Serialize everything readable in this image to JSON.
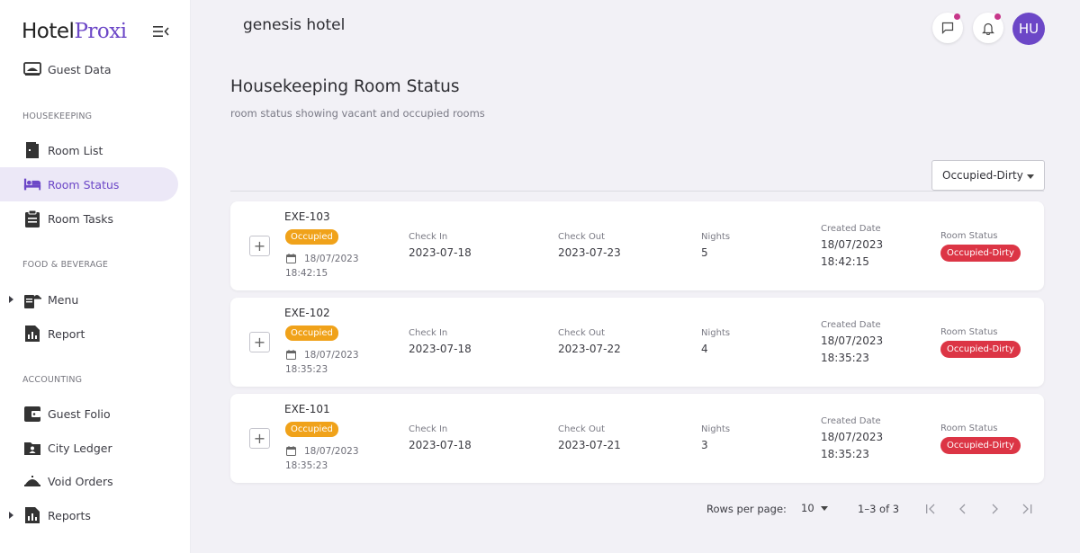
{
  "app": {
    "logo_main": "Hotel",
    "logo_brand": "Proxi",
    "brand_color": "#6c47c7"
  },
  "sidebar": {
    "partial_item": "Guest Data",
    "sections": {
      "housekeeping": "HOUSEKEEPING",
      "food_beverage": "FOOD & BEVERAGE",
      "accounting": "ACCOUNTING"
    },
    "items": {
      "room_list": "Room List",
      "room_status": "Room Status",
      "room_tasks": "Room Tasks",
      "menu": "Menu",
      "report": "Report",
      "guest_folio": "Guest Folio",
      "city_ledger": "City Ledger",
      "void_orders": "Void Orders",
      "reports": "Reports"
    },
    "active": "room_status"
  },
  "topbar": {
    "hotel_name": "genesis hotel",
    "avatar_initials": "HU"
  },
  "page": {
    "title": "Housekeeping Room Status",
    "subtitle": "room status showing vacant and occupied rooms",
    "filter_value": "Occupied-Dirty"
  },
  "labels": {
    "check_in": "Check In",
    "check_out": "Check Out",
    "nights": "Nights",
    "created_date": "Created Date",
    "room_status": "Room Status"
  },
  "rooms": [
    {
      "room": "EXE-103",
      "occupancy": "Occupied",
      "date": "18/07/2023",
      "time": "18:42:15",
      "check_in": "2023-07-18",
      "check_out": "2023-07-23",
      "nights": "5",
      "created_date": "18/07/2023",
      "created_time": "18:42:15",
      "status": "Occupied-Dirty"
    },
    {
      "room": "EXE-102",
      "occupancy": "Occupied",
      "date": "18/07/2023",
      "time": "18:35:23",
      "check_in": "2023-07-18",
      "check_out": "2023-07-22",
      "nights": "4",
      "created_date": "18/07/2023",
      "created_time": "18:35:23",
      "status": "Occupied-Dirty"
    },
    {
      "room": "EXE-101",
      "occupancy": "Occupied",
      "date": "18/07/2023",
      "time": "18:35:23",
      "check_in": "2023-07-18",
      "check_out": "2023-07-21",
      "nights": "3",
      "created_date": "18/07/2023",
      "created_time": "18:35:23",
      "status": "Occupied-Dirty"
    }
  ],
  "pagination": {
    "rows_label": "Rows per page:",
    "rows_value": "10",
    "range": "1–3 of 3"
  },
  "colors": {
    "occupied": "#f0a21a",
    "dirty": "#dc3545",
    "notification_dot": "#c7378a"
  }
}
